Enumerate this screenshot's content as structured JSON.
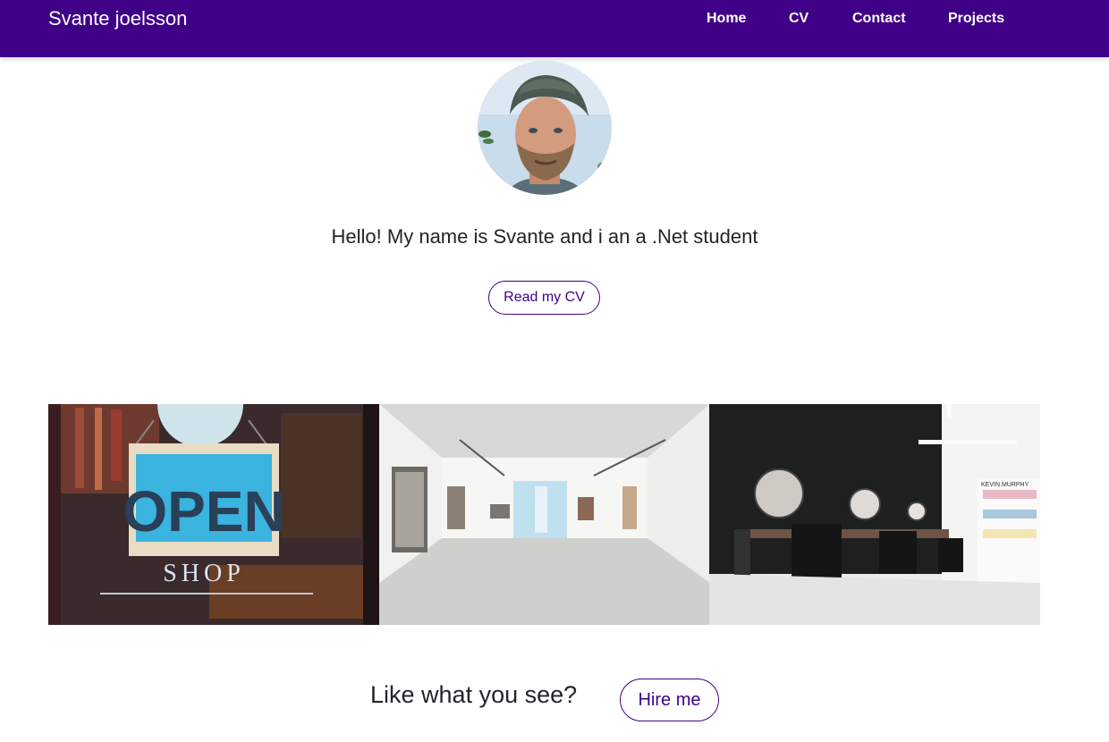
{
  "navbar": {
    "brand": "Svante joelsson",
    "links": [
      {
        "label": "Home"
      },
      {
        "label": "CV"
      },
      {
        "label": "Contact"
      },
      {
        "label": "Projects"
      }
    ]
  },
  "hero": {
    "greeting": "Hello! My name is Svante and i an a .Net student",
    "cv_button": "Read my CV"
  },
  "gallery": {
    "images": [
      {
        "name": "open-shop-sign-photo",
        "sign_text": "OPEN",
        "sub_text": "SHOP"
      },
      {
        "name": "white-art-gallery-photo"
      },
      {
        "name": "hair-salon-interior-photo",
        "brand_text": "KEVIN.MURPHY"
      }
    ]
  },
  "cta": {
    "text": "Like what you see?",
    "button": "Hire me"
  },
  "colors": {
    "brand": "#3f0087",
    "text": "#212529",
    "background": "#ffffff"
  }
}
